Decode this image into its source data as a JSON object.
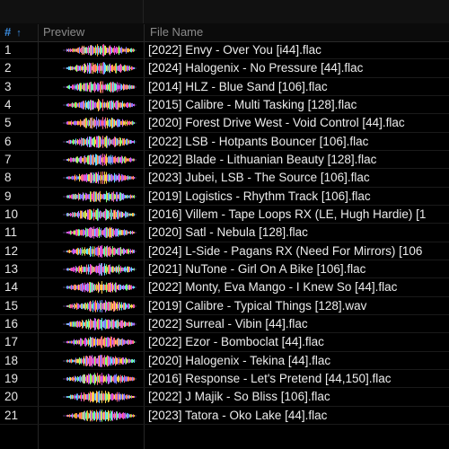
{
  "columns": {
    "number": "#",
    "sort_indicator": "↑",
    "preview": "Preview",
    "file_name": "File Name"
  },
  "tracks": [
    {
      "num": "1",
      "file": "[2022] Envy - Over You [i44].flac"
    },
    {
      "num": "2",
      "file": "[2024] Halogenix - No Pressure [44].flac"
    },
    {
      "num": "3",
      "file": "[2014] HLZ - Blue Sand [106].flac"
    },
    {
      "num": "4",
      "file": "[2015] Calibre - Multi Tasking [128].flac"
    },
    {
      "num": "5",
      "file": "[2020] Forest Drive West - Void Control [44].flac"
    },
    {
      "num": "6",
      "file": "[2022] LSB - Hotpants Bouncer [106].flac"
    },
    {
      "num": "7",
      "file": "[2022] Blade - Lithuanian Beauty [128].flac"
    },
    {
      "num": "8",
      "file": "[2023] Jubei, LSB - The Source [106].flac"
    },
    {
      "num": "9",
      "file": "[2019] Logistics - Rhythm Track [106].flac"
    },
    {
      "num": "10",
      "file": "[2016] Villem - Tape Loops RX (LE, Hugh Hardie) [1"
    },
    {
      "num": "11",
      "file": "[2020] Satl - Nebula [128].flac"
    },
    {
      "num": "12",
      "file": "[2024] L-Side - Pagans RX (Need For Mirrors) [106"
    },
    {
      "num": "13",
      "file": "[2021] NuTone - Girl On A Bike [106].flac"
    },
    {
      "num": "14",
      "file": "[2022] Monty, Eva Mango - I Knew So [44].flac"
    },
    {
      "num": "15",
      "file": "[2019] Calibre - Typical Things [128].wav"
    },
    {
      "num": "16",
      "file": "[2022] Surreal - Vibin [44].flac"
    },
    {
      "num": "17",
      "file": "[2022] Ezor - Bomboclat [44].flac"
    },
    {
      "num": "18",
      "file": "[2020] Halogenix - Tekina [44].flac"
    },
    {
      "num": "19",
      "file": "[2016] Response - Let's Pretend [44,150].flac"
    },
    {
      "num": "20",
      "file": "[2022] J Majik - So Bliss [106].flac"
    },
    {
      "num": "21",
      "file": "[2023] Tatora - Oko Lake [44].flac"
    }
  ],
  "colors": {
    "accent": "#3b8de0",
    "header_text": "#8a8a8a",
    "waveform": [
      "#e04bd0",
      "#ff6a8a",
      "#ff9a3c",
      "#5fe0ff",
      "#7a7bff",
      "#7dff7a",
      "#ffd24a",
      "#c46bff"
    ]
  }
}
